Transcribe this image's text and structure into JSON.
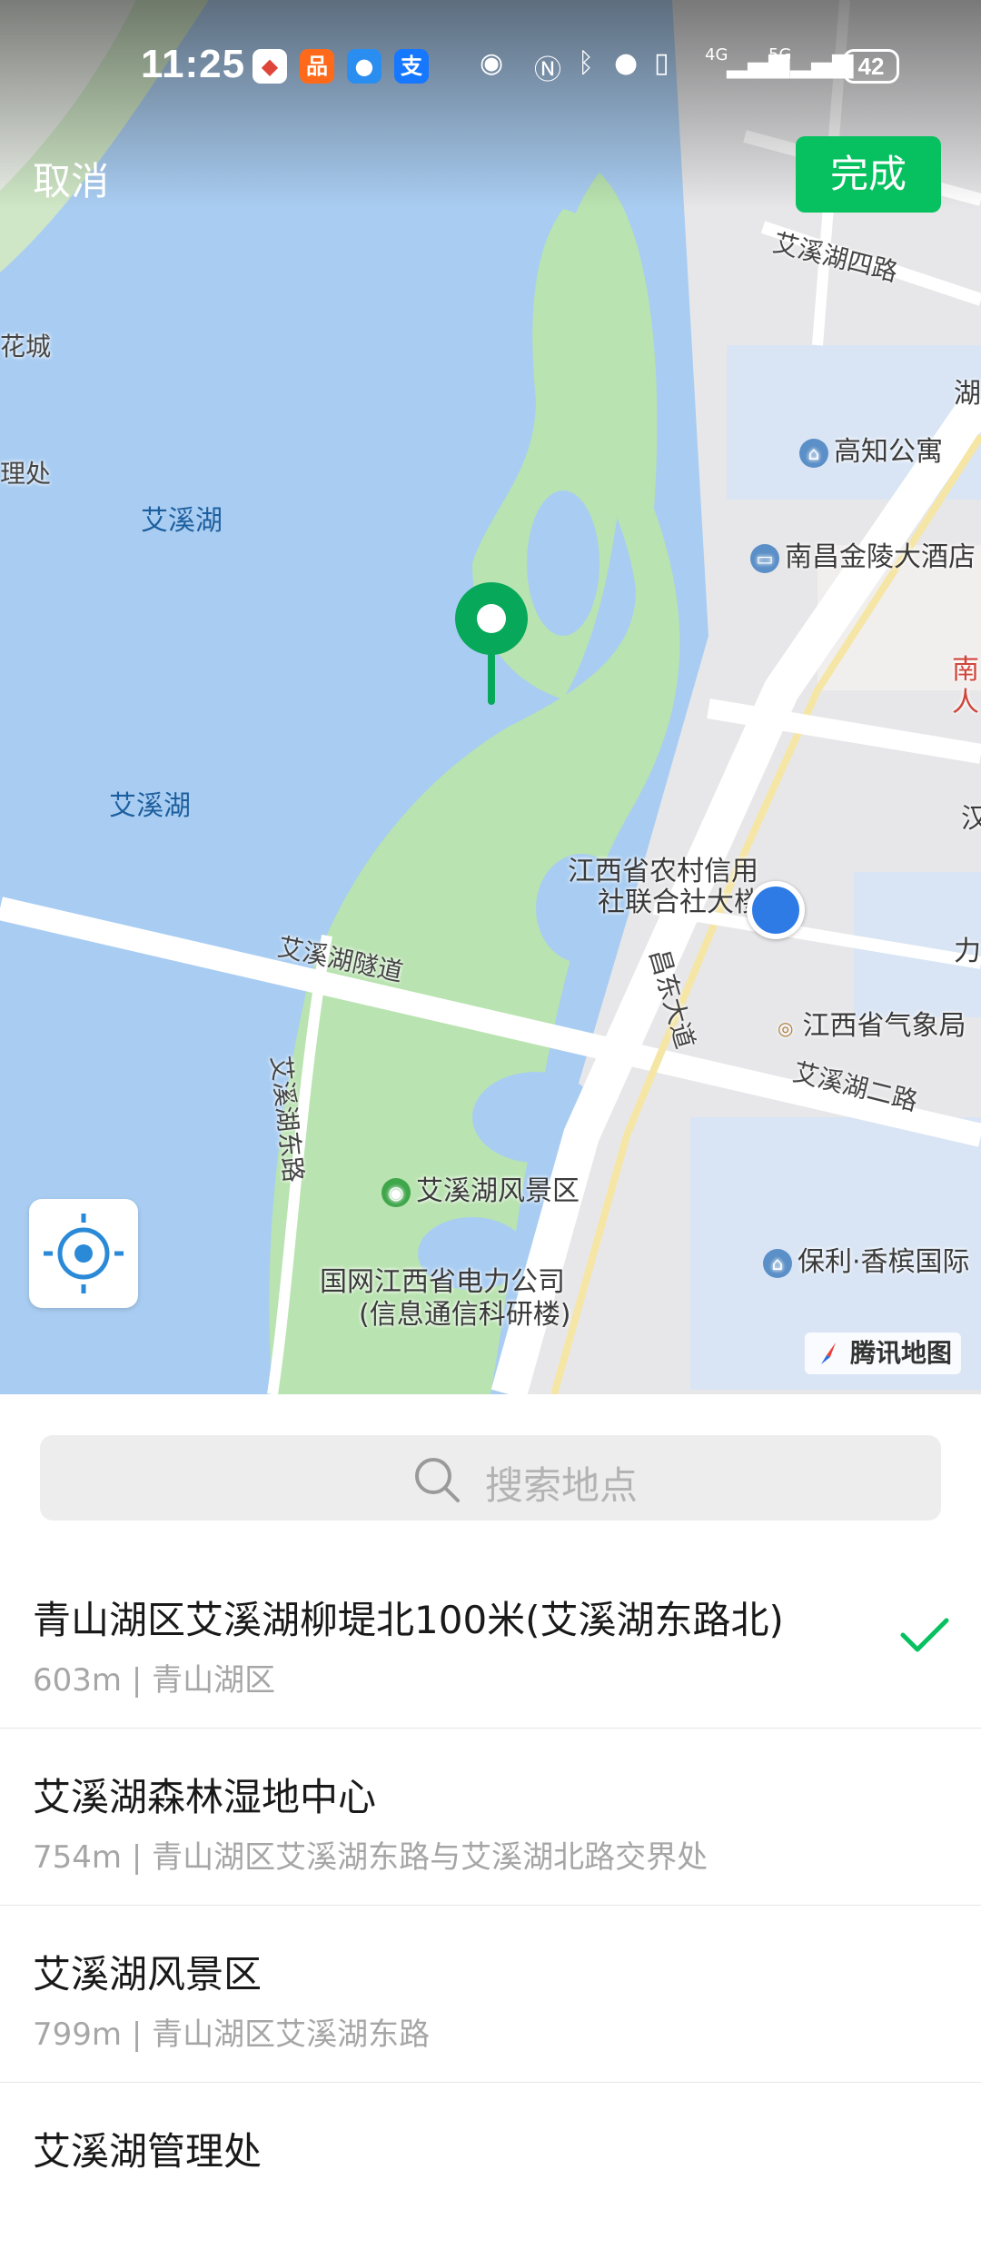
{
  "status": {
    "time": "11:25",
    "battery": "42",
    "network_4g": "4G",
    "network_5g": "5G"
  },
  "header": {
    "cancel_label": "取消",
    "done_label": "完成"
  },
  "map": {
    "labels": {
      "lake_1": "艾溪湖",
      "lake_2": "艾溪湖",
      "edge_city": "花城",
      "edge_office": "理处",
      "road_north4": "艾溪湖四路",
      "road_tunnel": "艾溪湖隧道",
      "road_east_1": "艾溪湖东路",
      "road_changdong": "昌东大道",
      "road_2": "艾溪湖二路",
      "poi_gaozhi": "高知公寓",
      "poi_jinling": "南昌金陵大酒店",
      "poi_rcu_1": "江西省农村信用",
      "poi_rcu_2": "社联合社大楼",
      "poi_weather": "江西省气象局",
      "poi_scenic": "艾溪湖风景区",
      "poi_grid_1": "国网江西省电力公司",
      "poi_grid_2": "(信息通信科研楼)",
      "poi_poly": "保利·香槟国际",
      "poi_edge_1": "湖",
      "poi_edge_2": "南",
      "poi_edge_3": "人",
      "poi_edge_4": "汉",
      "poi_edge_5": "力"
    },
    "provider": "腾讯地图"
  },
  "search": {
    "placeholder": "搜索地点"
  },
  "results": [
    {
      "title": "青山湖区艾溪湖柳堤北100米(艾溪湖东路北)",
      "subtitle": "603m | 青山湖区",
      "selected": true
    },
    {
      "title": "艾溪湖森林湿地中心",
      "subtitle": "754m | 青山湖区艾溪湖东路与艾溪湖北路交界处",
      "selected": false
    },
    {
      "title": "艾溪湖风景区",
      "subtitle": "799m | 青山湖区艾溪湖东路",
      "selected": false
    },
    {
      "title": "艾溪湖管理处",
      "subtitle": "",
      "selected": false
    }
  ],
  "colors": {
    "accent": "#07c160",
    "water": "#a9cdf2",
    "park": "#b9e3b0",
    "user_dot": "#2f7be5"
  }
}
